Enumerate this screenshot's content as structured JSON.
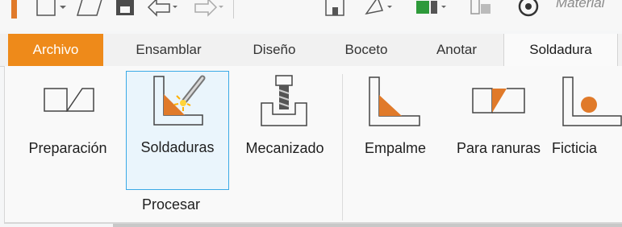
{
  "qat": {
    "search_text": "Material"
  },
  "tabs": [
    {
      "id": "archivo",
      "label": "Archivo"
    },
    {
      "id": "ensamblar",
      "label": "Ensamblar"
    },
    {
      "id": "diseno",
      "label": "Diseño"
    },
    {
      "id": "boceto",
      "label": "Boceto"
    },
    {
      "id": "anotar",
      "label": "Anotar"
    },
    {
      "id": "soldadura",
      "label": "Soldadura"
    }
  ],
  "active_tab": "Soldadura",
  "ribbon": {
    "buttons": [
      {
        "id": "preparacion",
        "label": "Preparación"
      },
      {
        "id": "soldaduras",
        "label": "Soldaduras"
      },
      {
        "id": "mecanizado",
        "label": "Mecanizado"
      },
      {
        "id": "empalme",
        "label": "Empalme"
      },
      {
        "id": "para_ranuras",
        "label": "Para ranuras"
      },
      {
        "id": "ficticia",
        "label": "Ficticia"
      }
    ],
    "group_label": "Procesar"
  },
  "colors": {
    "file_tab": "#ee8a1a",
    "weld_orange": "#e07a2a",
    "selection_border": "#3aa9e6"
  }
}
